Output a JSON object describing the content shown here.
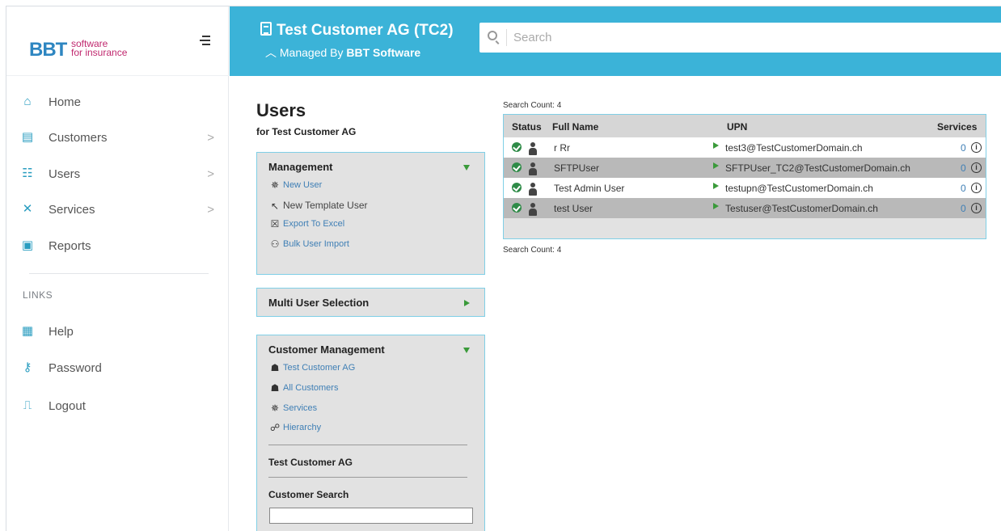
{
  "sidebar": {
    "brand": {
      "name": "BBT",
      "tagline_1": "software",
      "tagline_2": "for insurance"
    },
    "nav": [
      {
        "label": "Home",
        "icon": "home-icon"
      },
      {
        "label": "Customers",
        "icon": "building-icon",
        "chevron": ">"
      },
      {
        "label": "Users",
        "icon": "users-icon",
        "chevron": ">"
      },
      {
        "label": "Services",
        "icon": "tools-icon",
        "chevron": ">"
      },
      {
        "label": "Reports",
        "icon": "report-icon"
      }
    ],
    "links_label": "LINKS",
    "links": [
      {
        "label": "Help",
        "icon": "help-icon"
      },
      {
        "label": "Password",
        "icon": "key-icon"
      },
      {
        "label": "Logout",
        "icon": "logout-icon"
      }
    ]
  },
  "header": {
    "title": "Test Customer AG (TC2)",
    "managed_prefix": "Managed By",
    "managed_by": "BBT Software",
    "search_placeholder": "Search"
  },
  "page": {
    "title": "Users",
    "subtitle": "for Test Customer AG"
  },
  "management": {
    "title": "Management",
    "items": [
      {
        "label": "New User",
        "icon": "new-user-icon"
      },
      {
        "label": "New Template User",
        "icon": "template-icon"
      },
      {
        "label": "Export To Excel",
        "icon": "excel-icon"
      },
      {
        "label": "Bulk User Import",
        "icon": "bulk-import-icon"
      }
    ]
  },
  "multi_user": {
    "title": "Multi User Selection"
  },
  "customer_management": {
    "title": "Customer Management",
    "items": [
      {
        "label": "Test Customer AG",
        "icon": "customer-icon"
      },
      {
        "label": "All Customers",
        "icon": "all-customers-icon"
      },
      {
        "label": "Services",
        "icon": "services-icon"
      },
      {
        "label": "Hierarchy",
        "icon": "hierarchy-icon"
      }
    ],
    "current_customer": "Test Customer AG",
    "search_label": "Customer Search"
  },
  "results": {
    "count_top": "Search Count: 4",
    "count_bottom": "Search Count: 4",
    "columns": [
      "Status",
      "Full Name",
      "UPN",
      "Services"
    ],
    "rows": [
      {
        "name": "r Rr",
        "upn": "test3@TestCustomerDomain.ch",
        "services": "0"
      },
      {
        "name": "SFTPUser",
        "upn": "SFTPUser_TC2@TestCustomerDomain.ch",
        "services": "0"
      },
      {
        "name": "Test Admin User",
        "upn": "testupn@TestCustomerDomain.ch",
        "services": "0"
      },
      {
        "name": "test User",
        "upn": "Testuser@TestCustomerDomain.ch",
        "services": "0"
      }
    ]
  }
}
